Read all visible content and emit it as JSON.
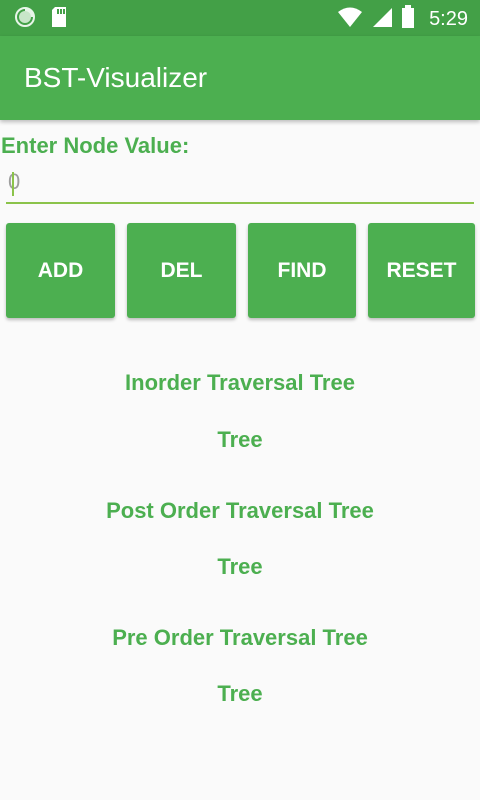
{
  "status_bar": {
    "time": "5:29",
    "icons": [
      "pie-chart-icon",
      "sd-card-icon",
      "wifi-icon",
      "signal-icon",
      "battery-icon"
    ]
  },
  "app_bar": {
    "title": "BST-Visualizer"
  },
  "form": {
    "label": "Enter Node Value:",
    "input_value": "",
    "input_placeholder": "0"
  },
  "buttons": {
    "add": "ADD",
    "del": "DEL",
    "find": "FIND",
    "reset": "RESET"
  },
  "traversals": {
    "inorder_title": "Inorder Traversal Tree",
    "inorder_value": "Tree",
    "postorder_title": "Post Order Traversal Tree",
    "postorder_value": "Tree",
    "preorder_title": "Pre Order Traversal Tree",
    "preorder_value": "Tree"
  },
  "colors": {
    "primary": "#4caf50",
    "primary_dark": "#43a047",
    "accent": "#8bc34a",
    "background": "#fafafa"
  }
}
